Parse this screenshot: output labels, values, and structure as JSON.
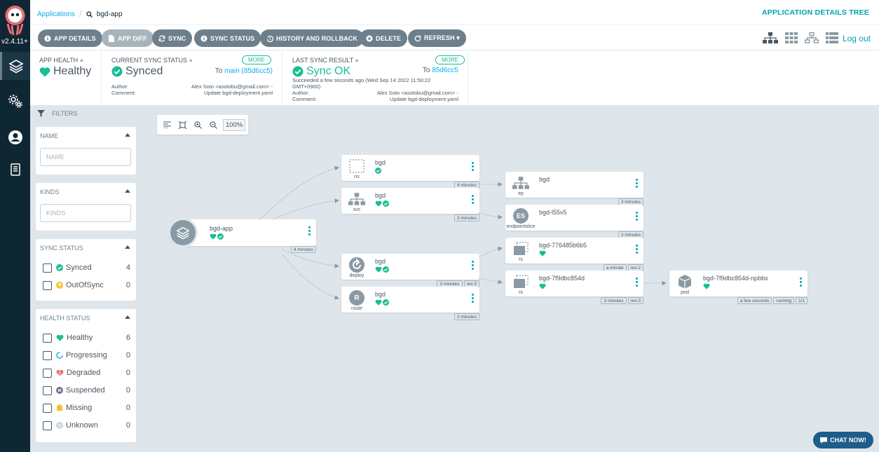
{
  "app": {
    "version": "v2.4.11+"
  },
  "breadcrumb": {
    "root": "Applications",
    "current": "bgd-app"
  },
  "page_title": "APPLICATION DETAILS TREE",
  "actions": [
    {
      "label": "APP DETAILS"
    },
    {
      "label": "APP DIFF"
    },
    {
      "label": "SYNC"
    },
    {
      "label": "SYNC STATUS"
    },
    {
      "label": "HISTORY AND ROLLBACK"
    },
    {
      "label": "DELETE"
    },
    {
      "label": "REFRESH ▾"
    }
  ],
  "logout": "Log out",
  "summary": {
    "health": {
      "label": "APP HEALTH",
      "value": "Healthy"
    },
    "sync": {
      "label": "CURRENT SYNC STATUS",
      "value": "Synced",
      "more": "MORE",
      "to_prefix": "To",
      "to_value": "main (85d6cc5)",
      "author_label": "Author:",
      "author": "Alex Soto <asotobu@gmail.com> -",
      "comment_label": "Comment:",
      "comment": "Update bgd-deployment.yaml"
    },
    "last": {
      "label": "LAST SYNC RESULT",
      "value": "Sync OK",
      "more": "MORE",
      "to_prefix": "To",
      "to_value": "85d6cc5",
      "succeeded": "Succeeded a few seconds ago (Wed Sep 14 2022 11:50:22",
      "succeeded2": "GMT+0900)",
      "author_label": "Author:",
      "author": "Alex Soto <asotobu@gmail.com> -",
      "comment_label": "Comment:",
      "comment": "Update bgd-deployment.yaml"
    }
  },
  "filters": {
    "title": "FILTERS",
    "name": {
      "title": "NAME",
      "placeholder": "NAME"
    },
    "kinds": {
      "title": "KINDS",
      "placeholder": "KINDS"
    },
    "sync_status": {
      "title": "SYNC STATUS",
      "items": [
        {
          "label": "Synced",
          "count": "4"
        },
        {
          "label": "OutOfSync",
          "count": "0"
        }
      ]
    },
    "health_status": {
      "title": "HEALTH STATUS",
      "items": [
        {
          "label": "Healthy",
          "count": "6"
        },
        {
          "label": "Progressing",
          "count": "0"
        },
        {
          "label": "Degraded",
          "count": "0"
        },
        {
          "label": "Suspended",
          "count": "0"
        },
        {
          "label": "Missing",
          "count": "0"
        },
        {
          "label": "Unknown",
          "count": "0"
        }
      ]
    }
  },
  "zoom": "100%",
  "nodes": {
    "app": {
      "name": "bgd-app",
      "tags": [
        "4 minutes"
      ]
    },
    "ns": {
      "name": "bgd",
      "kind": "ns",
      "tags": [
        "4 minutes"
      ]
    },
    "svc": {
      "name": "bgd",
      "kind": "svc",
      "tags": [
        "3 minutes"
      ]
    },
    "deploy": {
      "name": "bgd",
      "kind": "deploy",
      "tags": [
        "3 minutes",
        "rev:3"
      ]
    },
    "route": {
      "name": "bgd",
      "kind": "route",
      "icon_letter": "R",
      "tags": [
        "3 minutes"
      ]
    },
    "ep": {
      "name": "bgd",
      "kind": "ep",
      "tags": [
        "3 minutes"
      ]
    },
    "es": {
      "name": "bgd-l55v5",
      "kind": "endpointslice",
      "icon_letter": "ES",
      "tags": [
        "3 minutes"
      ]
    },
    "rs1": {
      "name": "bgd-776485b6b5",
      "kind": "rs",
      "tags": [
        "a minute",
        "rev:2"
      ]
    },
    "rs2": {
      "name": "bgd-7f9dbc854d",
      "kind": "rs",
      "tags": [
        "3 minutes",
        "rev:3"
      ]
    },
    "pod": {
      "name": "bgd-7f9dbc854d-npbbx",
      "kind": "pod",
      "tags": [
        "a few seconds",
        "running",
        "1/1"
      ]
    }
  },
  "chat": "CHAT NOW!",
  "colors": {
    "healthy": "#18be94",
    "accent": "#00a2b3",
    "nav": "#0f2733",
    "button": "#6d7f8b"
  }
}
